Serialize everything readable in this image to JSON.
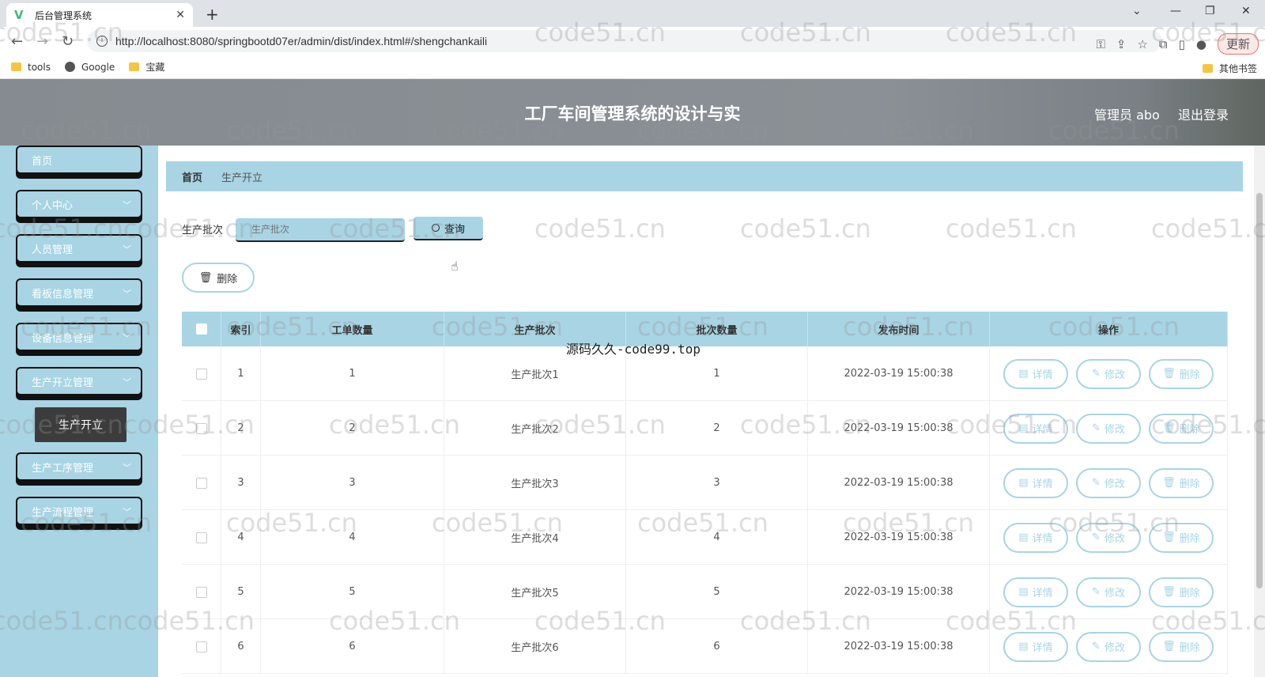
{
  "browser": {
    "tab_title": "后台管理系统",
    "url": "http://localhost:8080/springbootd07er/admin/dist/index.html#/shengchankaili",
    "update_label": "更新",
    "bookmarks": [
      "tools",
      "Google",
      "宝藏"
    ],
    "other_bookmarks": "其他书签"
  },
  "header": {
    "title": "工厂车间管理系统的设计与实",
    "user": "管理员 abo",
    "logout": "退出登录"
  },
  "sidebar": {
    "items": [
      {
        "label": "首页"
      },
      {
        "label": "个人中心"
      },
      {
        "label": "人员管理"
      },
      {
        "label": "看板信息管理"
      },
      {
        "label": "设备信息管理"
      },
      {
        "label": "生产开立管理"
      },
      {
        "label": "生产工序管理"
      },
      {
        "label": "生产流程管理"
      }
    ],
    "submenu_active": "生产开立"
  },
  "breadcrumb": {
    "home": "首页",
    "current": "生产开立"
  },
  "search": {
    "label": "生产批次",
    "placeholder": "生产批次",
    "button": "查询"
  },
  "toolbar": {
    "delete": "删除"
  },
  "table": {
    "headers": [
      "索引",
      "工单数量",
      "生产批次",
      "批次数量",
      "发布时间",
      "操作"
    ],
    "rows": [
      {
        "index": "1",
        "count": "1",
        "batch": "生产批次1",
        "batch_qty": "1",
        "time": "2022-03-19 15:00:38"
      },
      {
        "index": "2",
        "count": "2",
        "batch": "生产批次2",
        "batch_qty": "2",
        "time": "2022-03-19 15:00:38"
      },
      {
        "index": "3",
        "count": "3",
        "batch": "生产批次3",
        "batch_qty": "3",
        "time": "2022-03-19 15:00:38"
      },
      {
        "index": "4",
        "count": "4",
        "batch": "生产批次4",
        "batch_qty": "4",
        "time": "2022-03-19 15:00:38"
      },
      {
        "index": "5",
        "count": "5",
        "batch": "生产批次5",
        "batch_qty": "5",
        "time": "2022-03-19 15:00:38"
      },
      {
        "index": "6",
        "count": "6",
        "batch": "生产批次6",
        "batch_qty": "6",
        "time": "2022-03-19 15:00:38"
      }
    ],
    "actions": {
      "detail": "详情",
      "edit": "修改",
      "delete": "删除"
    }
  },
  "watermark": {
    "center": "源码久久-code99.top",
    "tile": "code51.cn"
  },
  "colors": {
    "accent": "#a8d4e4",
    "header": "#888e93",
    "submenu": "#3c3c3c"
  }
}
